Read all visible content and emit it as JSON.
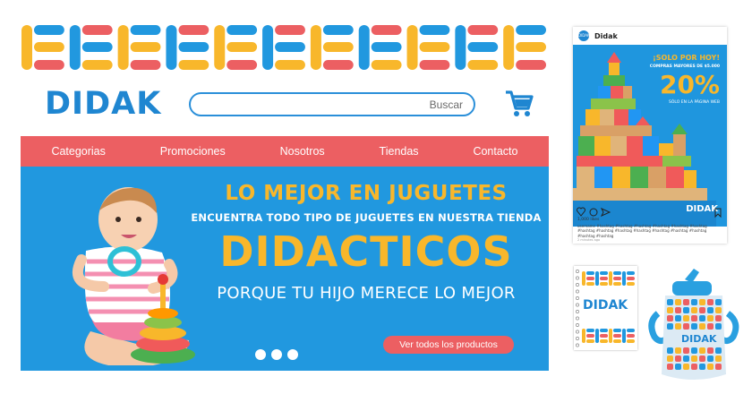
{
  "brand": {
    "logo_text": "DIDAK"
  },
  "colors": {
    "blue": "#2198df",
    "orange": "#f8b72b",
    "coral": "#ec5f62"
  },
  "search": {
    "placeholder": "",
    "button_label": "Buscar"
  },
  "cart": {
    "icon": "shopping-cart-icon"
  },
  "nav": {
    "items": [
      {
        "label": "Categorias"
      },
      {
        "label": "Promociones"
      },
      {
        "label": "Nosotros"
      },
      {
        "label": "Tiendas"
      },
      {
        "label": "Contacto"
      }
    ]
  },
  "hero": {
    "line1": "LO MEJOR EN JUGUETES",
    "line2": "ENCUENTRA TODO TIPO DE JUGUETES EN NUESTRA TIENDA",
    "line3": "DIDACTICOS",
    "line4": "PORQUE TU HIJO MERECE LO MEJOR",
    "cta": "Ver todos los productos",
    "slides": 3
  },
  "instagram": {
    "account_name": "Didak",
    "avatar_text": "DIDAK",
    "promo_line1": "¡SOLO POR HOY!",
    "promo_line2": "COMPRAS MAYORES DE $5.000",
    "promo_discount": "20%",
    "promo_line4": "SÓLO EN LA PÁGINA WEB",
    "image_logo": "DIDAK",
    "likes": "1,000 likes",
    "caption": "username #hashtag #hashtag #hashtag #hashtag #hashtag #hashtag #hashtag #hashtag #hashtag #hashtag #hashtag #hashtag #hashtag #hashtag #hashtag",
    "time": "2 minutes ago"
  },
  "merch": {
    "notebook_logo": "DIDAK",
    "bottle_logo": "DIDAK"
  }
}
